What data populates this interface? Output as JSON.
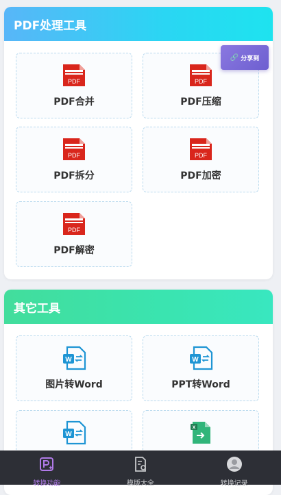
{
  "pdf_section": {
    "title": "PDF处理工具",
    "tools": [
      {
        "label": "PDF合并",
        "icon": "pdf-icon"
      },
      {
        "label": "PDF压缩",
        "icon": "pdf-icon"
      },
      {
        "label": "PDF拆分",
        "icon": "pdf-icon"
      },
      {
        "label": "PDF加密",
        "icon": "pdf-icon"
      },
      {
        "label": "PDF解密",
        "icon": "pdf-icon"
      }
    ],
    "pdf_icon_text": "PDF"
  },
  "share_button": {
    "label": "分享到",
    "icon": "link-icon"
  },
  "other_section": {
    "title": "其它工具",
    "tools": [
      {
        "label": "图片转Word",
        "icon": "word-icon"
      },
      {
        "label": "PPT转Word",
        "icon": "word-icon"
      },
      {
        "label": "",
        "icon": "word-icon"
      },
      {
        "label": "",
        "icon": "excel-icon"
      }
    ],
    "word_icon_text": "W",
    "excel_icon_text": "X"
  },
  "bottom_nav": {
    "items": [
      {
        "label": "转换功能",
        "icon": "convert-icon",
        "active": true
      },
      {
        "label": "模版大全",
        "icon": "template-icon",
        "active": false
      },
      {
        "label": "转换记录",
        "icon": "user-avatar-icon",
        "active": false
      }
    ]
  },
  "colors": {
    "accent": "#b07ae8",
    "pdf_red": "#d9261c",
    "word_blue": "#1e95d4",
    "excel_green": "#31b57a"
  }
}
